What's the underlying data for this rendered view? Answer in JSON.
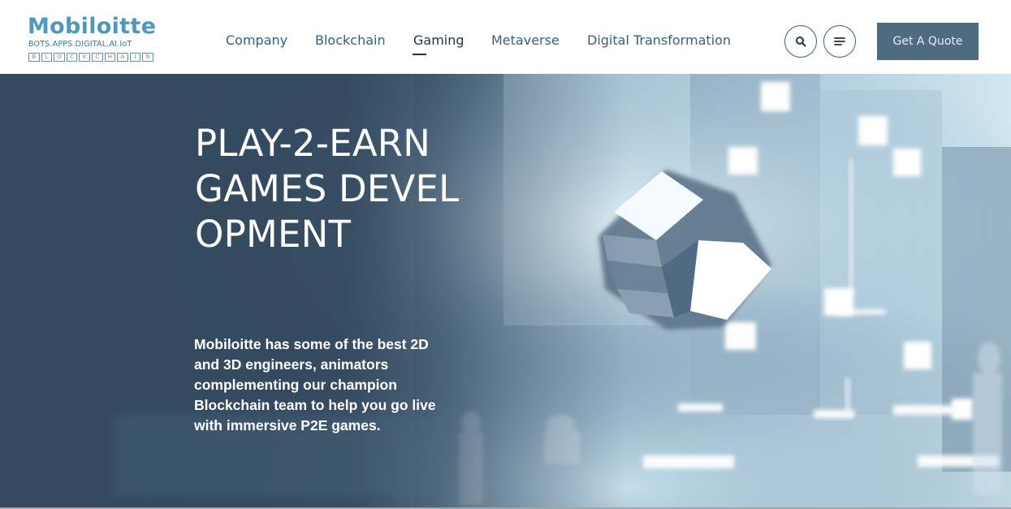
{
  "brand": {
    "name": "Mobiloitte",
    "tagline": "BOTS.APPS.DIGITAL.AI.IoT",
    "sub_letters": [
      "B",
      "L",
      "O",
      "C",
      "K",
      "C",
      "H",
      "A",
      "I",
      "N"
    ]
  },
  "nav": {
    "items": [
      {
        "label": "Company"
      },
      {
        "label": "Blockchain"
      },
      {
        "label": "Gaming",
        "active": true
      },
      {
        "label": "Metaverse"
      },
      {
        "label": "Digital Transformation"
      }
    ]
  },
  "header": {
    "search_icon": "search-icon",
    "menu_icon": "menu-icon",
    "quote_label": "Get A Quote"
  },
  "hero": {
    "title": "PLAY-2-EARN GAMES DEVELOPMENT",
    "description": "Mobiloitte has some of the best 2D and 3D engineers, animators complementing our champion Blockchain team to help you go live with immersive P2E games."
  },
  "colors": {
    "brand": "#4f97bd",
    "nav_text": "#3a5f78",
    "button_bg": "#4f6b80",
    "hero_bg": "#34495e"
  }
}
